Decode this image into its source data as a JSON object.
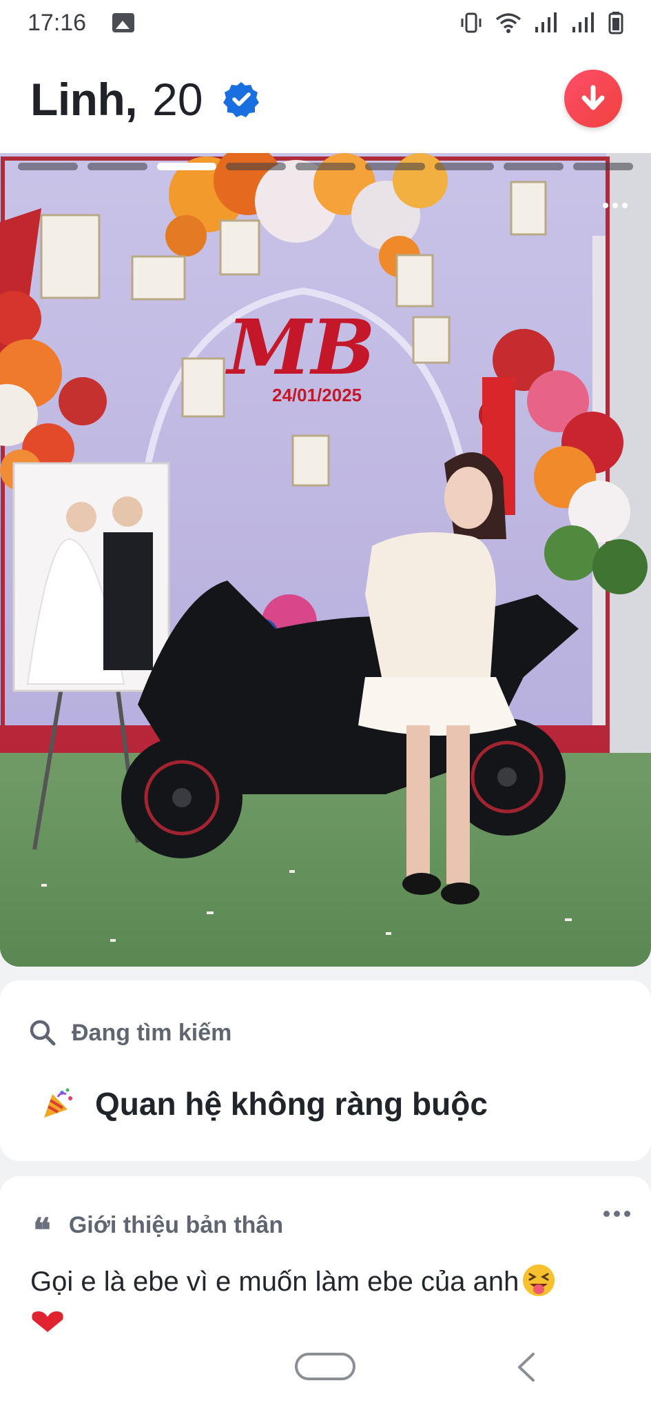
{
  "status_bar": {
    "time": "17:16",
    "icons": [
      "gallery-icon",
      "vibrate-icon",
      "wifi-icon",
      "signal-icon",
      "signal-icon",
      "battery-icon"
    ]
  },
  "header": {
    "name": "Linh,",
    "age": "20",
    "verified": true,
    "accent": "#fd4e6a"
  },
  "photo": {
    "segments": 9,
    "active_segment": 3,
    "caption_date": "24/01/2025",
    "monogram": "MB"
  },
  "looking_for": {
    "label": "Đang tìm kiếm",
    "value": "Quan hệ không ràng buộc",
    "icon": "party-popper-icon"
  },
  "about": {
    "label": "Giới thiệu bản thân",
    "text": "Gọi e là ebe vì e muốn làm ebe của anh"
  },
  "nav": {
    "home": "home-button",
    "back": "back-button"
  }
}
